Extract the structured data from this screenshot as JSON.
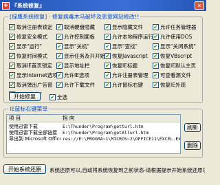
{
  "window": {
    "title": "『系统修复』"
  },
  "group_main": {
    "title": "[绿鹰系统修复] · 修复病毒木马破坏及恶意网站修改!!"
  },
  "checkboxes": [
    {
      "label": "取消注册表锁定",
      "checked": true
    },
    {
      "label": "取消硬盘隐藏",
      "checked": true
    },
    {
      "label": "显示隐藏文件",
      "checked": true
    },
    {
      "label": "允许任务管理器",
      "checked": true
    },
    {
      "label": "修复安全模式",
      "checked": true
    },
    {
      "label": "允许控制面板",
      "checked": true
    },
    {
      "label": "允许本地程序运行",
      "checked": true
    },
    {
      "label": "允许使用DOS",
      "checked": true
    },
    {
      "label": "显示\"运行\"",
      "checked": true
    },
    {
      "label": "显示\"关机\"",
      "checked": true
    },
    {
      "label": "显示\"查找\"",
      "checked": true
    },
    {
      "label": "显示\"关闭系统\"",
      "checked": true
    },
    {
      "label": "恢复时间模式",
      "checked": true
    },
    {
      "label": "显示任务及开开始",
      "checked": true
    },
    {
      "label": "恢复Javascript",
      "checked": true
    },
    {
      "label": "恢复VBscript",
      "checked": true
    },
    {
      "label": "取消IE首页锁定",
      "checked": true
    },
    {
      "label": "显示地址栏",
      "checked": true
    },
    {
      "label": "恢复IE标题",
      "checked": true
    },
    {
      "label": "恢复IE默认主页",
      "checked": true
    },
    {
      "label": "显示Internet选项",
      "checked": true
    },
    {
      "label": "允许IE选项",
      "checked": true
    },
    {
      "label": "允许注册表管理",
      "checked": true
    },
    {
      "label": "可查看源文件",
      "checked": true
    },
    {
      "label": "取消弹出广告窗",
      "checked": true
    },
    {
      "label": "允许下载文件",
      "checked": true
    },
    {
      "label": "允许鼠标右键",
      "checked": true
    },
    {
      "label": "恢复IE外观",
      "checked": true
    },
    {
      "label": "显示\"文件\"",
      "checked": true
    }
  ],
  "repair_button": "开始修复",
  "select_all": {
    "label": "全选",
    "checked": true
  },
  "ie_menu": {
    "title": "IE鼠标右键菜单",
    "col_item": "项 目",
    "col_target": "指 向",
    "rows": [
      {
        "item": "使用迅雷下载",
        "target": "E:\\Thunder\\Program\\getturl.htm"
      },
      {
        "item": "使用迅雷下载全部链接",
        "target": "E:\\Thunder\\Program\\getAllurl.htm"
      },
      {
        "item": "导出到 Microsoft Office Excel (&X)",
        "target": "res://E:\\PROGRA~1\\MICROS~2\\OFFICE11\\EXCEL.EXE/3000"
      }
    ],
    "refresh_button": "刷新",
    "delete_button": "删除"
  },
  "restore_button": "开始系统还原",
  "status_text": "系统还原可以,自动将系统恢复到之前状态-请根据提示开始系统还原功能"
}
